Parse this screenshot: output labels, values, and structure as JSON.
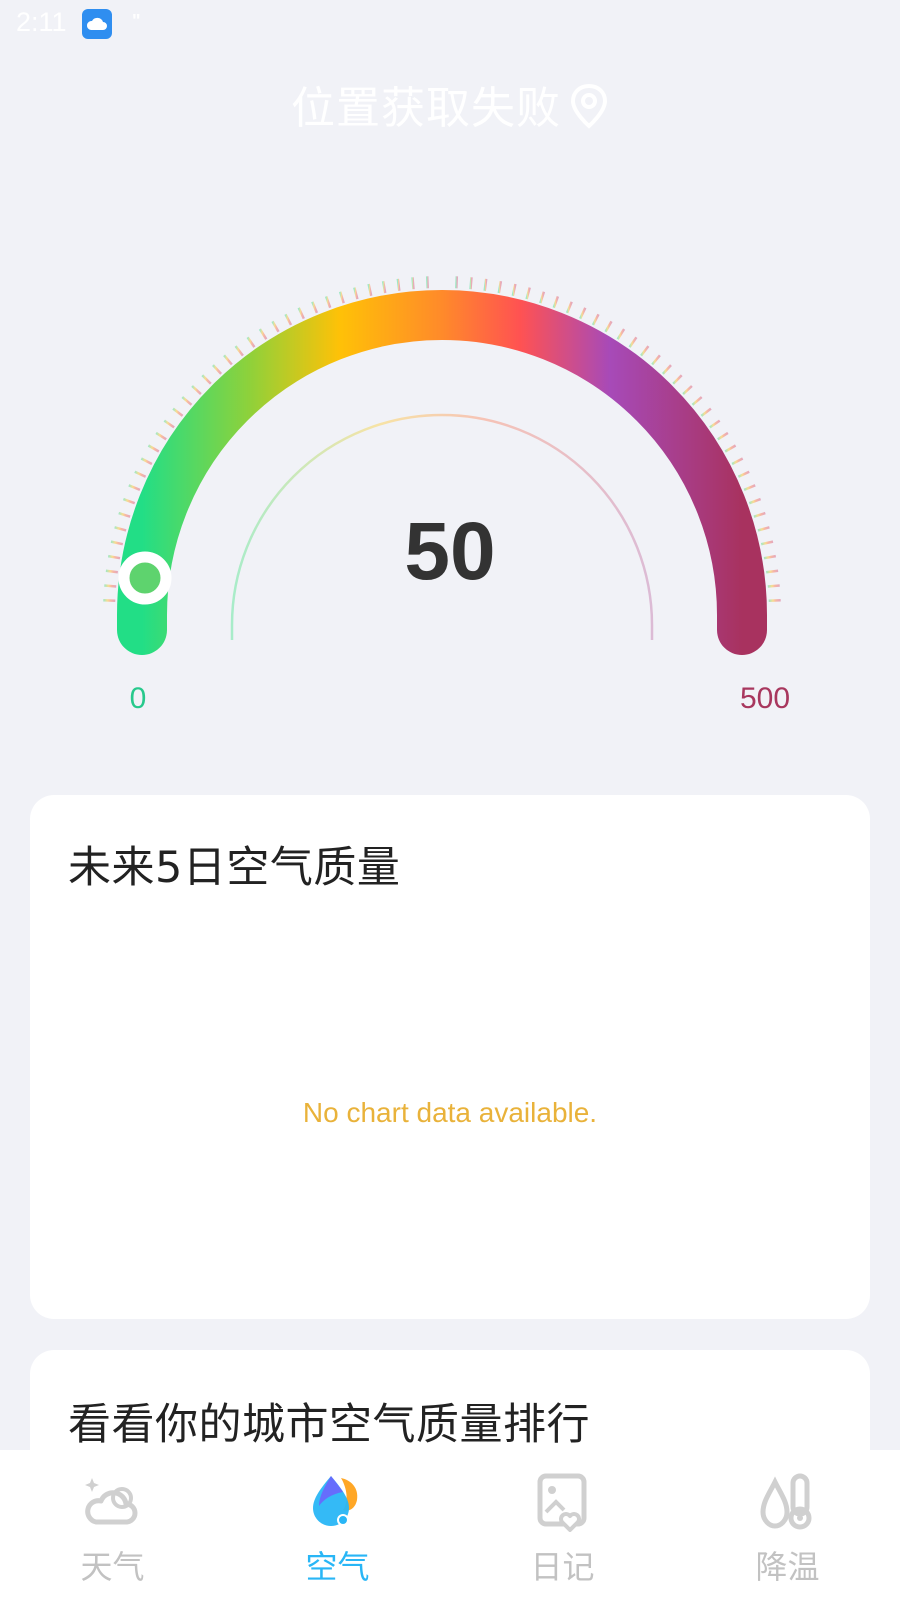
{
  "status_bar": {
    "time": "2:11",
    "notification_indicator": "\"",
    "app_icon": "cloud-app-icon"
  },
  "header": {
    "location_text": "位置获取失败",
    "location_icon": "location-pin-icon"
  },
  "gauge": {
    "value": "50",
    "min_label": "0",
    "max_label": "500",
    "min": 0,
    "max": 500,
    "current": 50,
    "colors": [
      "#22de86",
      "#8fd13a",
      "#ffc107",
      "#ff8a2a",
      "#ff5252",
      "#a74ab8",
      "#a8325f"
    ]
  },
  "forecast_card": {
    "title": "未来5日空气质量",
    "empty_message": "No chart data available."
  },
  "ranking_card": {
    "title": "看看你的城市空气质量排行"
  },
  "bottom_nav": {
    "items": [
      {
        "label": "天气",
        "icon": "weather-cloud-icon",
        "active": false
      },
      {
        "label": "空气",
        "icon": "air-drop-icon",
        "active": true
      },
      {
        "label": "日记",
        "icon": "diary-photo-icon",
        "active": false
      },
      {
        "label": "降温",
        "icon": "thermometer-drop-icon",
        "active": false
      }
    ],
    "active_color": "#29b6f6",
    "inactive_color": "#c2c2c2"
  }
}
